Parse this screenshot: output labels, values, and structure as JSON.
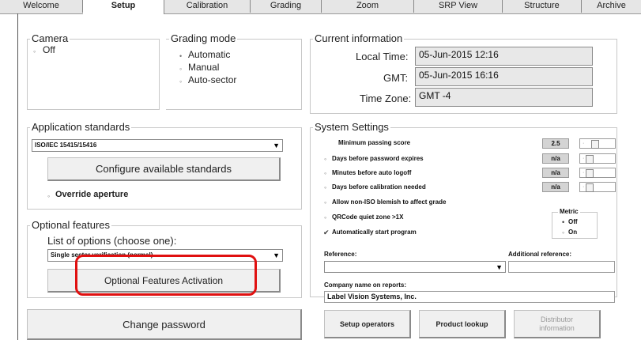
{
  "tabs": [
    "Welcome",
    "Setup",
    "Calibration",
    "Grading",
    "Zoom",
    "SRP View",
    "Structure",
    "Archive"
  ],
  "active_tab": "Setup",
  "camera": {
    "title": "Camera",
    "option": "Off"
  },
  "grading_mode": {
    "title": "Grading mode",
    "options": [
      "Automatic",
      "Manual",
      "Auto-sector"
    ]
  },
  "current_info": {
    "title": "Current information",
    "local_time_label": "Local Time:",
    "local_time": "05-Jun-2015 12:16",
    "gmt_label": "GMT:",
    "gmt": "05-Jun-2015 16:16",
    "tz_label": "Time Zone:",
    "tz": "GMT -4"
  },
  "app_standards": {
    "title": "Application standards",
    "selected": "ISO/IEC 15415/15416",
    "configure_button": "Configure available standards",
    "override_aperture": "Override aperture"
  },
  "optional_features": {
    "title": "Optional features",
    "list_label": "List of options (choose one):",
    "selected": "Single sector verification (normal)",
    "activation_button": "Optional Features Activation"
  },
  "change_password_button": "Change password",
  "system_settings": {
    "title": "System Settings",
    "min_score_label": "Minimum passing score",
    "min_score_value": "2.5",
    "rows": [
      {
        "label": "Days before password expires",
        "value": "n/a"
      },
      {
        "label": "Minutes before auto logoff",
        "value": "n/a"
      },
      {
        "label": "Days before calibration needed",
        "value": "n/a"
      }
    ],
    "allow_blemish": "Allow non-ISO blemish to affect grade",
    "qrcode_quiet": "QRCode quiet zone >1X",
    "auto_start": "Automatically start program",
    "metric": {
      "title": "Metric",
      "off": "Off",
      "on": "On"
    },
    "reference_label": "Reference:",
    "additional_reference_label": "Additional reference:",
    "company_label": "Company name on reports:",
    "company_value": "Label Vision Systems, Inc."
  },
  "bottom_buttons": {
    "setup_operators": "Setup operators",
    "product_lookup": "Product lookup",
    "distributor_information": "Distributor information"
  },
  "accent_color": "#e01010"
}
